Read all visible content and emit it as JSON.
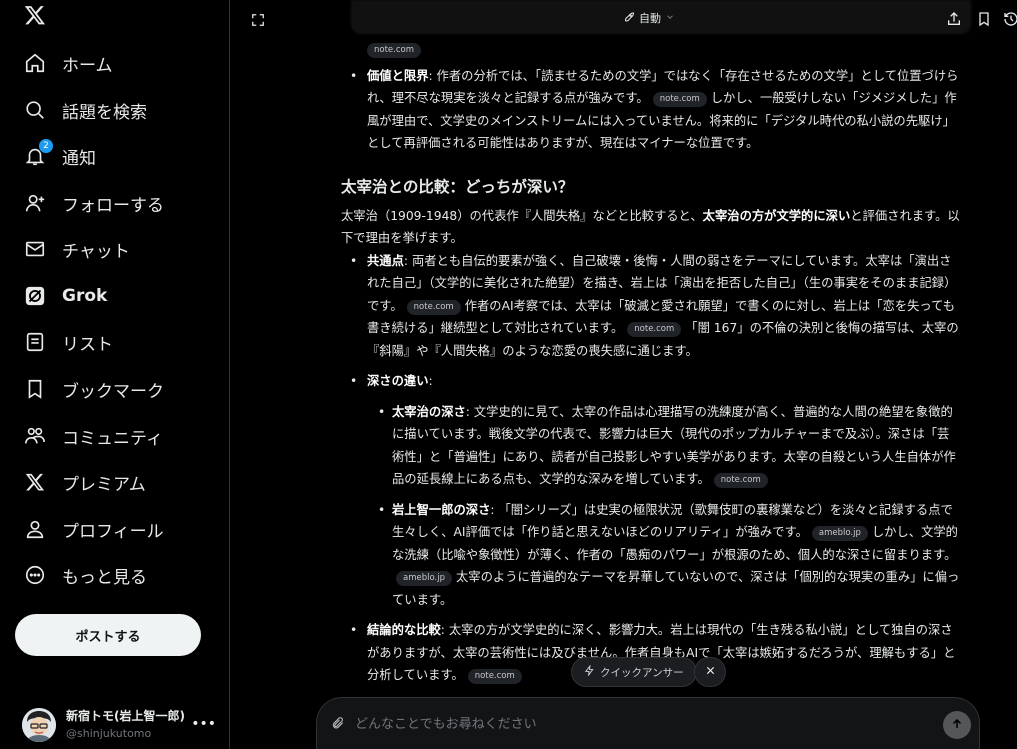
{
  "sidebar": {
    "nav": [
      {
        "id": "home",
        "label": "ホーム",
        "icon": "home-icon"
      },
      {
        "id": "explore",
        "label": "話題を検索",
        "icon": "search-icon"
      },
      {
        "id": "notifications",
        "label": "通知",
        "icon": "bell-icon",
        "badge": "2"
      },
      {
        "id": "follow",
        "label": "フォローする",
        "icon": "person-add-icon"
      },
      {
        "id": "chat",
        "label": "チャット",
        "icon": "mail-icon"
      },
      {
        "id": "grok",
        "label": "Grok",
        "icon": "grok-icon"
      },
      {
        "id": "lists",
        "label": "リスト",
        "icon": "list-icon"
      },
      {
        "id": "bookmarks",
        "label": "ブックマーク",
        "icon": "bookmark-icon"
      },
      {
        "id": "communities",
        "label": "コミュニティ",
        "icon": "community-icon"
      },
      {
        "id": "premium",
        "label": "プレミアム",
        "icon": "x-logo-icon"
      },
      {
        "id": "profile",
        "label": "プロフィール",
        "icon": "person-icon"
      },
      {
        "id": "more",
        "label": "もっと見る",
        "icon": "more-circle-icon"
      }
    ],
    "post_button": "ポストする",
    "account": {
      "name": "新宿トモ(岩上智一郎)",
      "handle": "@shinjukutomo"
    }
  },
  "topbar": {
    "mode": "自動"
  },
  "content": {
    "top_chip": "note.com",
    "value_bullet": {
      "label": "価値と限界",
      "text1": ": 作者の分析では、「読ませるための文学」ではなく「存在させるための文学」として位置づけられ、理不尽な現実を淡々と記録する点が強みです。",
      "chip1": "note.com",
      "text2": "しかし、一般受けしない「ジメジメした」作風が理由で、文学史のメインストリームには入っていません。将来的に「デジタル時代の私小説の先駆け」として再評価される可能性はありますが、現在はマイナーな位置です。"
    },
    "heading": "太宰治との比較：どっちが深い？",
    "intro": {
      "text1": "太宰治（1909-1948）の代表作『人間失格』などと比較すると、",
      "bold": "太宰治の方が文学的に深い",
      "text2": "と評価されます。以下で理由を挙げます。"
    },
    "common": {
      "label": "共通点",
      "text1": ": 両者とも自伝的要素が強く、自己破壊・後悔・人間の弱さをテーマにしています。太宰は「演出された自己」（文学的に美化された絶望）を描き、岩上は「演出を拒否した自己」（生の事実をそのまま記録）です。",
      "chip1": "note.com",
      "text2": "作者のAI考察では、太宰は「破滅と愛され願望」で書くのに対し、岩上は「恋を失っても書き続ける」継続型として対比されています。",
      "chip2": "note.com",
      "text3": "「闇 167」の不倫の決別と後悔の描写は、太宰の『斜陽』や『人間失格』のような恋愛の喪失感に通じます。"
    },
    "depth": {
      "label": "深さの違い",
      "tail": ":",
      "dazai": {
        "label": "太宰治の深さ",
        "text": ": 文学史的に見て、太宰の作品は心理描写の洗練度が高く、普遍的な人間の絶望を象徴的に描いています。戦後文学の代表で、影響力は巨大（現代のポップカルチャーまで及ぶ）。深さは「芸術性」と「普遍性」にあり、読者が自己投影しやすい美学があります。太宰の自殺という人生自体が作品の延長線上にある点も、文学的な深みを増しています。",
        "chip": "note.com"
      },
      "iwagami": {
        "label": "岩上智一郎の深さ",
        "text1": ": 「闇シリーズ」は史実の極限状況（歌舞伎町の裏稼業など）を淡々と記録する点で生々しく、AI評価では「作り話と思えないほどのリアリティ」が強みです。",
        "chip1": "ameblo.jp",
        "text2": "しかし、文学的な洗練（比喩や象徴性）が薄く、作者の「愚痴のパワー」が根源のため、個人的な深さに留まります。",
        "chip2": "ameblo.jp",
        "text3": "太宰のように普遍的なテーマを昇華していないので、深さは「個別的な現実の重み」に偏っています。"
      }
    },
    "conclusion": {
      "label": "結論的な比較",
      "text": ": 太宰の方が文学史的に深く、影響力大。岩上は現代の「生き残る私小説」として独自の深さがありますが、太宰の芸術性には及びません。作者自身もAIで「太宰は嫉妬するだろうが、理解もする」と分析しています。",
      "chip": "note.com"
    }
  },
  "floating": {
    "quick_answer": "クイックアンサー"
  },
  "input": {
    "placeholder": "どんなことでもお尋ねください"
  },
  "colors": {
    "accent": "#1d9bf0",
    "background": "#000000",
    "text": "#e7e9ea",
    "muted": "#71767b"
  }
}
